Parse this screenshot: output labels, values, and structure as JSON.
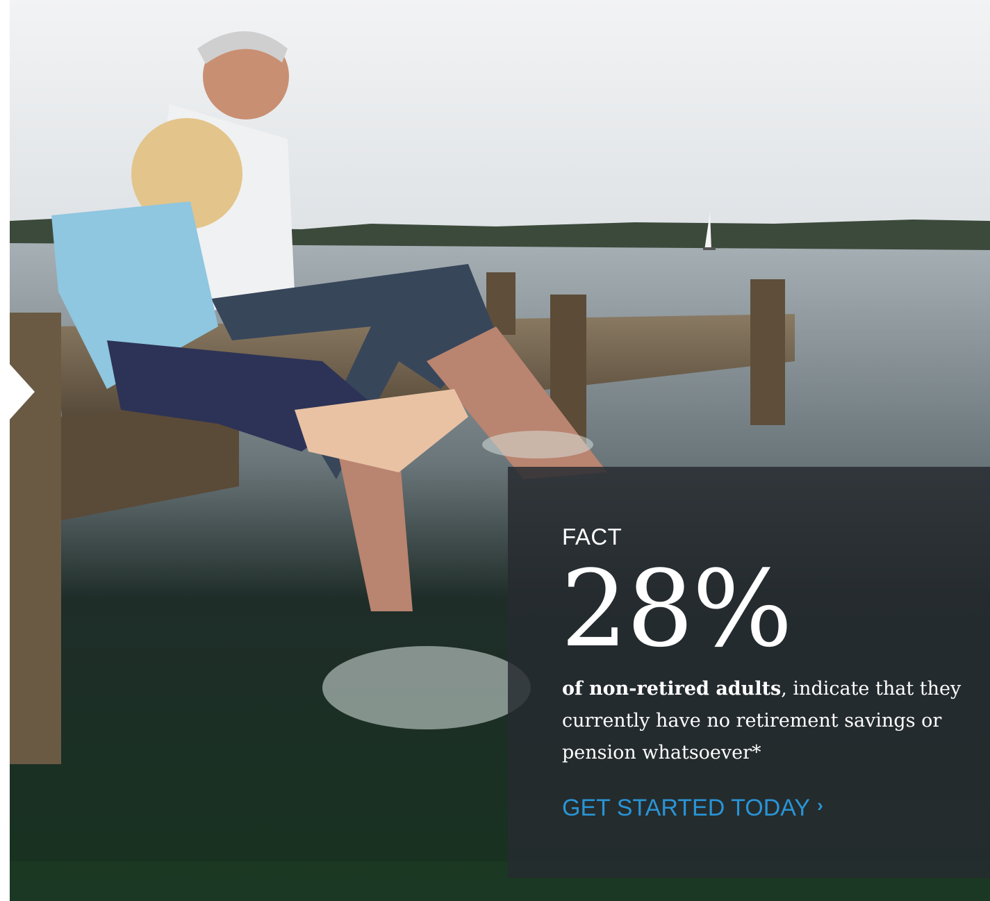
{
  "hero": {
    "image_description": "",
    "colors": {
      "sky": "#eceeef",
      "water": "#1a2b27",
      "panel": "#262b30",
      "cta": "#2a94d6"
    }
  },
  "fact": {
    "label": "FACT",
    "percentage": "28%",
    "body_lead": "of non-retired adults",
    "body_rest": ", indicate that they currently have no retirement savings or pension whatsoever*",
    "cta_label": "GET STARTED TODAY",
    "cta_icon": "chevron-right-icon"
  }
}
